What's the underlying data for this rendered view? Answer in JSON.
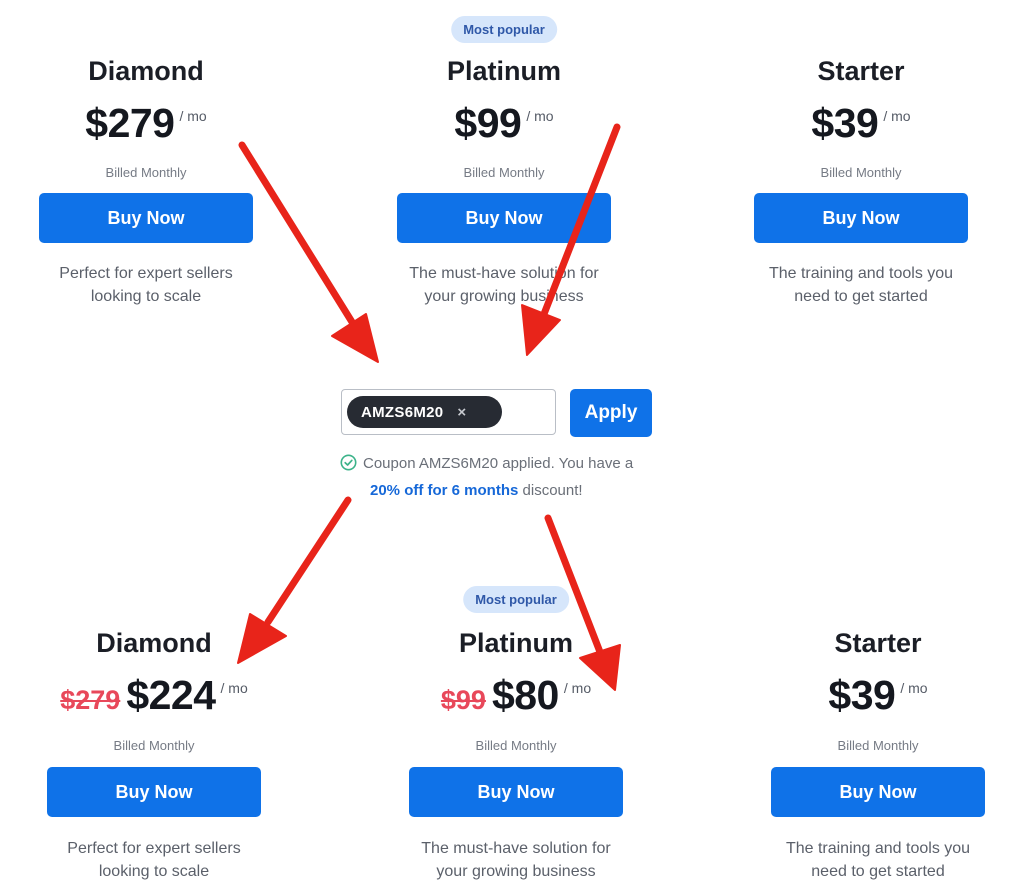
{
  "before": {
    "badge": "Most popular",
    "plans": [
      {
        "name": "Diamond",
        "price": "$279",
        "per": "/ mo",
        "billed": "Billed Monthly",
        "button": "Buy Now",
        "desc_line1": "Perfect for expert sellers",
        "desc_line2": "looking to scale"
      },
      {
        "name": "Platinum",
        "price": "$99",
        "per": "/ mo",
        "billed": "Billed Monthly",
        "button": "Buy Now",
        "desc_line1": "The must-have solution for",
        "desc_line2": "your growing business"
      },
      {
        "name": "Starter",
        "price": "$39",
        "per": "/ mo",
        "billed": "Billed Monthly",
        "button": "Buy Now",
        "desc_line1": "The training and tools you",
        "desc_line2": "need to get started"
      }
    ]
  },
  "coupon": {
    "code": "AMZS6M20",
    "remove_symbol": "×",
    "apply_label": "Apply",
    "msg_line1": "Coupon AMZS6M20 applied. You have a",
    "msg_highlight": "20% off for 6 months",
    "msg_tail": " discount!",
    "icon": "check-circle-icon",
    "success_color": "#3cb38a"
  },
  "after": {
    "badge": "Most popular",
    "plans": [
      {
        "name": "Diamond",
        "old_price": "$279",
        "price": "$224",
        "per": "/ mo",
        "billed": "Billed Monthly",
        "button": "Buy Now",
        "desc_line1": "Perfect for expert sellers",
        "desc_line2": "looking to scale"
      },
      {
        "name": "Platinum",
        "old_price": "$99",
        "price": "$80",
        "per": "/ mo",
        "billed": "Billed Monthly",
        "button": "Buy Now",
        "desc_line1": "The must-have solution for",
        "desc_line2": "your growing business"
      },
      {
        "name": "Starter",
        "price": "$39",
        "per": "/ mo",
        "billed": "Billed Monthly",
        "button": "Buy Now",
        "desc_line1": "The training and tools you",
        "desc_line2": "need to get started"
      }
    ]
  },
  "colors": {
    "button": "#0f72e8",
    "arrow": "#e8241a",
    "strike": "#e8485a",
    "badge_bg": "#d6e6fb"
  }
}
